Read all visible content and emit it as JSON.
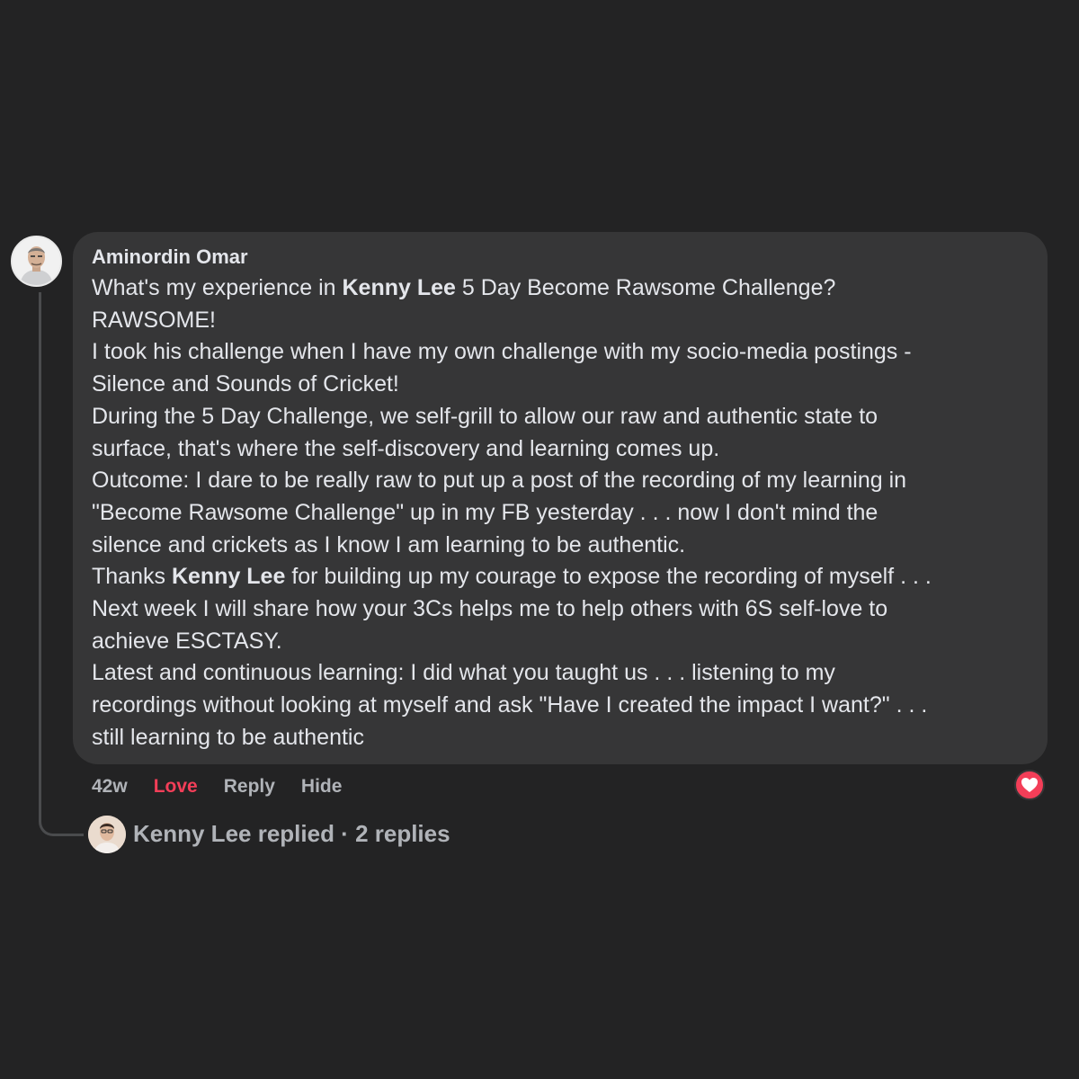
{
  "comment": {
    "author": "Aminordin Omar",
    "lines": [
      {
        "pre": "What's my experience in ",
        "bold": "Kenny Lee",
        "post": " 5 Day Become Rawsome Challenge?"
      },
      {
        "pre": "RAWSOME!",
        "bold": "",
        "post": ""
      },
      {
        "pre": "I took his challenge when I have my own challenge with my socio-media postings -",
        "bold": "",
        "post": ""
      },
      {
        "pre": "Silence and Sounds of Cricket!",
        "bold": "",
        "post": ""
      },
      {
        "pre": "During the 5 Day Challenge, we self-grill to allow our raw and authentic state to",
        "bold": "",
        "post": ""
      },
      {
        "pre": "surface, that's where the self-discovery and learning comes up.",
        "bold": "",
        "post": ""
      },
      {
        "pre": "Outcome: I dare to be really raw to put up a post of the recording of my learning in",
        "bold": "",
        "post": ""
      },
      {
        "pre": "\"Become Rawsome Challenge\" up in my FB yesterday . . . now I don't mind the",
        "bold": "",
        "post": ""
      },
      {
        "pre": "silence and crickets as I know I am learning to be authentic.",
        "bold": "",
        "post": ""
      },
      {
        "pre": "Thanks ",
        "bold": "Kenny Lee",
        "post": " for building up my courage to expose the recording of myself . . ."
      },
      {
        "pre": "Next week I will share how your 3Cs helps me to help others with 6S self-love to",
        "bold": "",
        "post": ""
      },
      {
        "pre": "achieve ESCTASY.",
        "bold": "",
        "post": ""
      },
      {
        "pre": "Latest and continuous learning: I did what you taught us . . . listening to my",
        "bold": "",
        "post": ""
      },
      {
        "pre": "recordings without looking at myself and ask \"Have I created the impact I want?\" . . .",
        "bold": "",
        "post": ""
      },
      {
        "pre": "still learning to be authentic",
        "bold": "",
        "post": ""
      }
    ]
  },
  "actions": {
    "time": "42w",
    "love": "Love",
    "reply": "Reply",
    "hide": "Hide"
  },
  "reaction": {
    "icon": "heart-icon",
    "color": "#f33e58"
  },
  "replies": {
    "text": "Kenny Lee replied · 2 replies"
  },
  "colors": {
    "background": "#232324",
    "bubble": "#363637",
    "love": "#f33e58",
    "secondary_text": "#b0b3b8"
  }
}
